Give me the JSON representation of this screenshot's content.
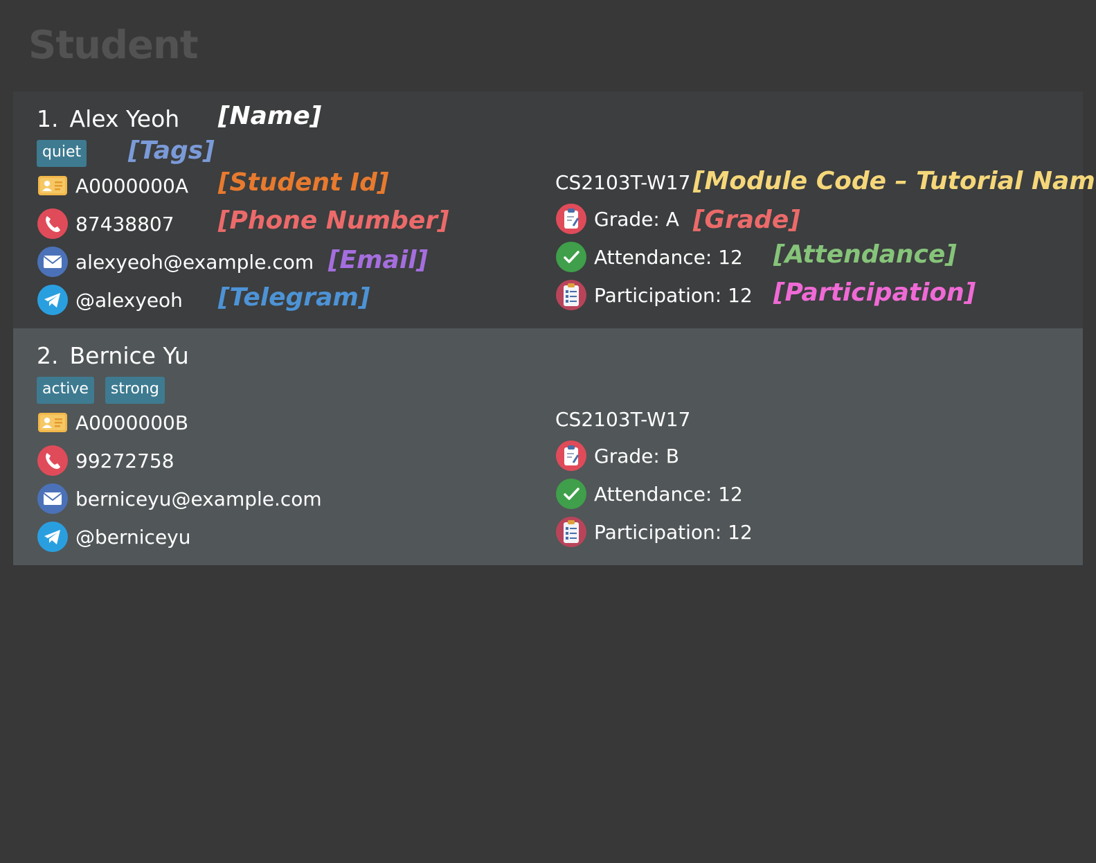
{
  "title": "Student",
  "students": [
    {
      "index": "1.",
      "name": "Alex Yeoh",
      "tags": [
        "quiet"
      ],
      "student_id": "A0000000A",
      "phone": "87438807",
      "email": "alexyeoh@example.com",
      "telegram": "@alexyeoh",
      "module_tutorial": "CS2103T-W17",
      "grade": "Grade: A",
      "attendance": "Attendance: 12",
      "participation": "Participation: 12"
    },
    {
      "index": "2.",
      "name": "Bernice Yu",
      "tags": [
        "active",
        "strong"
      ],
      "student_id": "A0000000B",
      "phone": "99272758",
      "email": "berniceyu@example.com",
      "telegram": "@berniceyu",
      "module_tutorial": "CS2103T-W17",
      "grade": "Grade: B",
      "attendance": "Attendance: 12",
      "participation": "Participation: 12"
    }
  ],
  "annotations": {
    "name": "[Name]",
    "tags": "[Tags]",
    "student_id": "[Student Id]",
    "phone": "[Phone Number]",
    "email": "[Email]",
    "telegram": "[Telegram]",
    "module": "[Module Code – Tutorial Name]",
    "grade": "[Grade]",
    "attendance": "[Attendance]",
    "participation": "[Participation]"
  },
  "annotation_colors": {
    "name": "#ffffff",
    "tags": "#7b9ad8",
    "student_id": "#e87a2e",
    "phone": "#ec6a6a",
    "email": "#a56ede",
    "telegram": "#4d93d6",
    "module": "#f5d77a",
    "grade": "#ec6a6a",
    "attendance": "#86c47a",
    "participation": "#f06ad6"
  },
  "icons": {
    "student_id": "id-card-icon",
    "phone": "phone-icon",
    "email": "email-icon",
    "telegram": "telegram-icon",
    "grade": "grade-clipboard-icon",
    "attendance": "attendance-check-icon",
    "participation": "participation-checklist-icon"
  }
}
